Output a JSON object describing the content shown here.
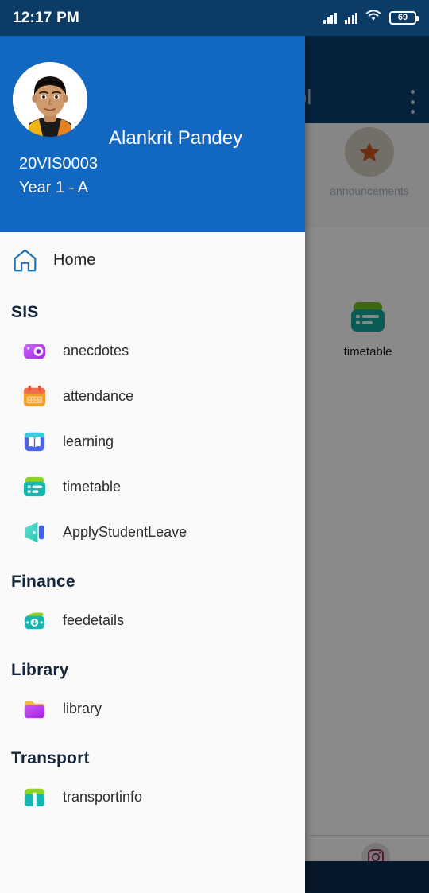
{
  "status_bar": {
    "time": "12:17 PM",
    "signal_icon": "signal-bars-icon",
    "wifi_icon": "wifi-icon",
    "battery_icon": "battery-icon",
    "battery_level": "69"
  },
  "background_app": {
    "app_bar_title": "chool",
    "overflow_icon": "overflow-menu-icon",
    "tiles": [
      {
        "label": "announcements",
        "icon": "star-icon"
      },
      {
        "label": "timetable",
        "icon": "timetable-icon"
      }
    ],
    "social_icon": "instagram-icon"
  },
  "drawer": {
    "header": {
      "avatar_icon": "student-avatar",
      "name": "Alankrit Pandey",
      "student_id": "20VIS0003",
      "class": "Year 1 - A",
      "background_color": "#1267c0"
    },
    "home": {
      "label": "Home",
      "icon": "home-icon"
    },
    "sections": [
      {
        "title": "SIS",
        "items": [
          {
            "label": "anecdotes",
            "icon": "camera-icon"
          },
          {
            "label": "attendance",
            "icon": "calendar-icon"
          },
          {
            "label": "learning",
            "icon": "book-icon"
          },
          {
            "label": "timetable",
            "icon": "timetable-card-icon"
          },
          {
            "label": "ApplyStudentLeave",
            "icon": "door-exit-icon"
          }
        ]
      },
      {
        "title": "Finance",
        "items": [
          {
            "label": "feedetails",
            "icon": "wallet-money-icon"
          }
        ]
      },
      {
        "title": "Library",
        "items": [
          {
            "label": "library",
            "icon": "folder-icon"
          }
        ]
      },
      {
        "title": "Transport",
        "items": [
          {
            "label": "transportinfo",
            "icon": "bus-icon"
          }
        ]
      }
    ]
  }
}
